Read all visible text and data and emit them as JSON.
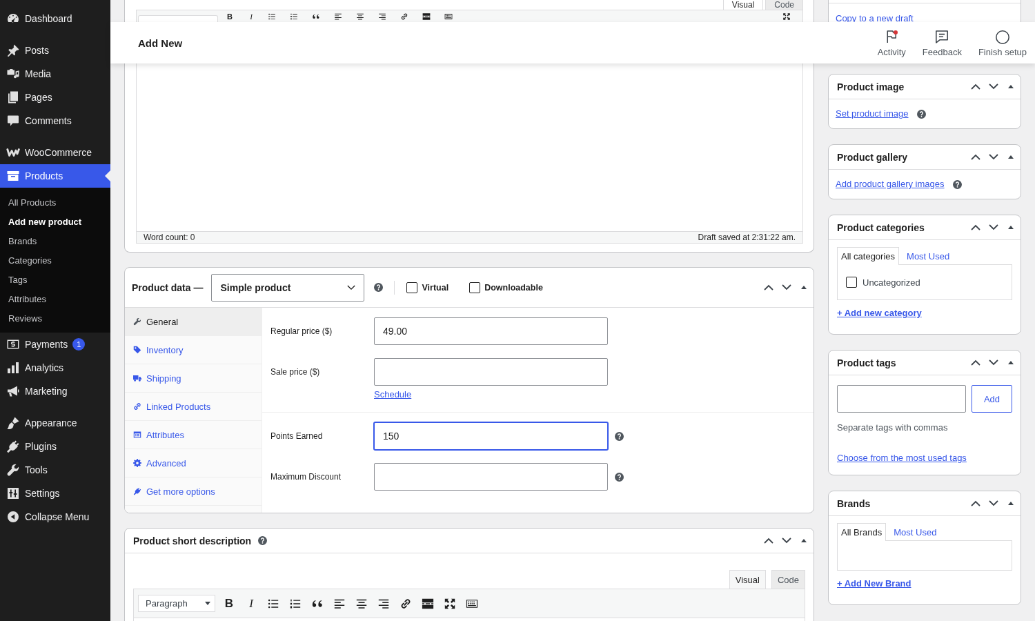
{
  "sidebar": {
    "groups": [
      {
        "items": [
          {
            "label": "Dashboard",
            "selected": false
          }
        ]
      },
      {
        "items": [
          {
            "label": "Posts",
            "selected": false
          },
          {
            "label": "Media",
            "selected": false
          },
          {
            "label": "Pages",
            "selected": false
          },
          {
            "label": "Comments",
            "selected": false
          }
        ]
      },
      {
        "items": [
          {
            "label": "WooCommerce",
            "selected": false
          },
          {
            "label": "Products",
            "selected": true,
            "submenu": [
              {
                "label": "All Products",
                "selected": false
              },
              {
                "label": "Add new product",
                "selected": true
              },
              {
                "label": "Brands",
                "selected": false
              },
              {
                "label": "Categories",
                "selected": false
              },
              {
                "label": "Tags",
                "selected": false
              },
              {
                "label": "Attributes",
                "selected": false
              },
              {
                "label": "Reviews",
                "selected": false
              }
            ]
          },
          {
            "label": "Payments",
            "selected": false,
            "badge": "1"
          },
          {
            "label": "Analytics",
            "selected": false
          },
          {
            "label": "Marketing",
            "selected": false
          }
        ]
      },
      {
        "items": [
          {
            "label": "Appearance",
            "selected": false
          },
          {
            "label": "Plugins",
            "selected": false
          },
          {
            "label": "Tools",
            "selected": false
          },
          {
            "label": "Settings",
            "selected": false
          },
          {
            "label": "Collapse Menu",
            "selected": false
          }
        ]
      }
    ]
  },
  "header": {
    "title": "Add New",
    "actions": [
      {
        "label": "Activity",
        "unread": true
      },
      {
        "label": "Feedback",
        "unread": false
      },
      {
        "label": "Finish setup",
        "unread": false
      }
    ]
  },
  "editor": {
    "tabs": [
      {
        "label": "Visual",
        "selected": true
      },
      {
        "label": "Code",
        "selected": false
      }
    ],
    "toolbar_letters": [
      "B",
      "I"
    ],
    "word_count": "Word count: 0",
    "draft_status": "Draft saved at 2:31:22 am."
  },
  "product_data": {
    "title": "Product data —",
    "product_type": "Simple product",
    "options": [
      {
        "label": "Virtual",
        "checked": false
      },
      {
        "label": "Downloadable",
        "checked": false
      }
    ],
    "tabs": [
      {
        "label": "General",
        "selected": true
      },
      {
        "label": "Inventory",
        "selected": false
      },
      {
        "label": "Shipping",
        "selected": false
      },
      {
        "label": "Linked Products",
        "selected": false
      },
      {
        "label": "Attributes",
        "selected": false
      },
      {
        "label": "Advanced",
        "selected": false
      },
      {
        "label": "Get more options",
        "selected": false
      }
    ],
    "field_groups": [
      {
        "fields": [
          {
            "label": "Regular price ($)",
            "value": "49.00",
            "focused": false,
            "help": false
          },
          {
            "label": "Sale price ($)",
            "focused": false,
            "help": false,
            "link": "Schedule"
          }
        ]
      },
      {
        "fields": [
          {
            "label": "Points Earned",
            "value": "150",
            "focused": true,
            "help": true
          },
          {
            "label": "Maximum Discount",
            "focused": false,
            "help": true
          }
        ]
      }
    ]
  },
  "short_description": {
    "title": "Product short description",
    "tabs": [
      {
        "label": "Visual",
        "selected": true
      },
      {
        "label": "Code",
        "selected": false
      }
    ],
    "format": "Paragraph",
    "toolbar_letters": [
      "B",
      "I"
    ]
  },
  "side_panel": {
    "publish_link": "Copy to a new draft",
    "boxes": [
      {
        "kind": "link",
        "title": "Product image",
        "link": "Set product image"
      },
      {
        "kind": "link",
        "title": "Product gallery",
        "link": "Add product gallery images"
      },
      {
        "kind": "taxonomy",
        "title": "Product categories",
        "tabs": [
          {
            "label": "All categories",
            "selected": true
          },
          {
            "label": "Most Used",
            "selected": false
          }
        ],
        "terms": [
          {
            "label": "Uncategorized",
            "checked": false
          }
        ],
        "add_link": "+ Add new category"
      },
      {
        "kind": "tags",
        "title": "Product tags",
        "button": "Add",
        "hint": "Separate tags with commas",
        "link": "Choose from the most used tags"
      },
      {
        "kind": "taxonomy",
        "title": "Brands",
        "tabs": [
          {
            "label": "All Brands",
            "selected": true
          },
          {
            "label": "Most Used",
            "selected": false
          }
        ],
        "add_link": "+ Add New Brand"
      }
    ]
  }
}
